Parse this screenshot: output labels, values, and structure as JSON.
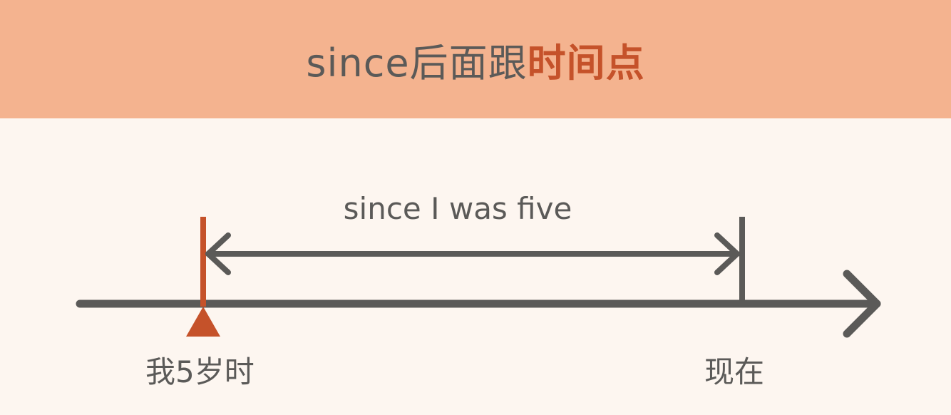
{
  "header": {
    "title_plain": "since后面跟",
    "title_highlight": "时间点"
  },
  "diagram": {
    "span_label": "since I was five",
    "start_label": "我5岁时",
    "end_label": "现在"
  },
  "colors": {
    "header_bg": "#f4b38f",
    "body_bg": "#fdf6f0",
    "accent": "#c5522a",
    "line": "#5b5a58"
  }
}
